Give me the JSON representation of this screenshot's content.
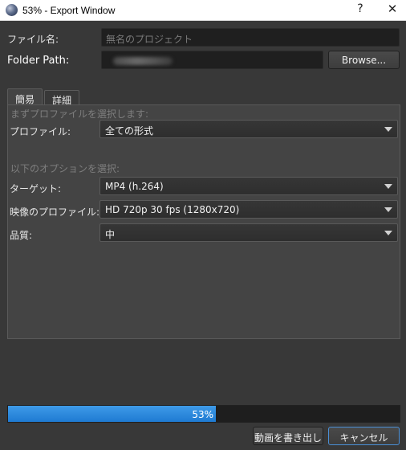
{
  "window": {
    "title": "53% - Export Window",
    "help": "?",
    "close": "✕"
  },
  "file_name": {
    "label": "ファイル名:",
    "placeholder": "無名のプロジェクト"
  },
  "folder_path": {
    "label": "Folder Path:",
    "browse_label": "Browse..."
  },
  "tabs": [
    {
      "label": "簡易",
      "active": true
    },
    {
      "label": "詳細",
      "active": false
    }
  ],
  "simple": {
    "profile_hint": "まずプロファイルを選択します:",
    "profile_label": "プロファイル:",
    "profile_value": "全ての形式",
    "options_hint": "以下のオプションを選択:",
    "target_label": "ターゲット:",
    "target_value": "MP4 (h.264)",
    "video_profile_label": "映像のプロファイル:",
    "video_profile_value": "HD 720p 30 fps (1280x720)",
    "quality_label": "品質:",
    "quality_value": "中"
  },
  "progress": {
    "value": 0.53,
    "text": "53%"
  },
  "buttons": {
    "export_label": "動画を書き出し",
    "cancel_label": "キャンセル"
  },
  "colors": {
    "background": "#383838",
    "progress_fill": "#2b8ae0",
    "cancel_border": "#4a8fd6"
  }
}
